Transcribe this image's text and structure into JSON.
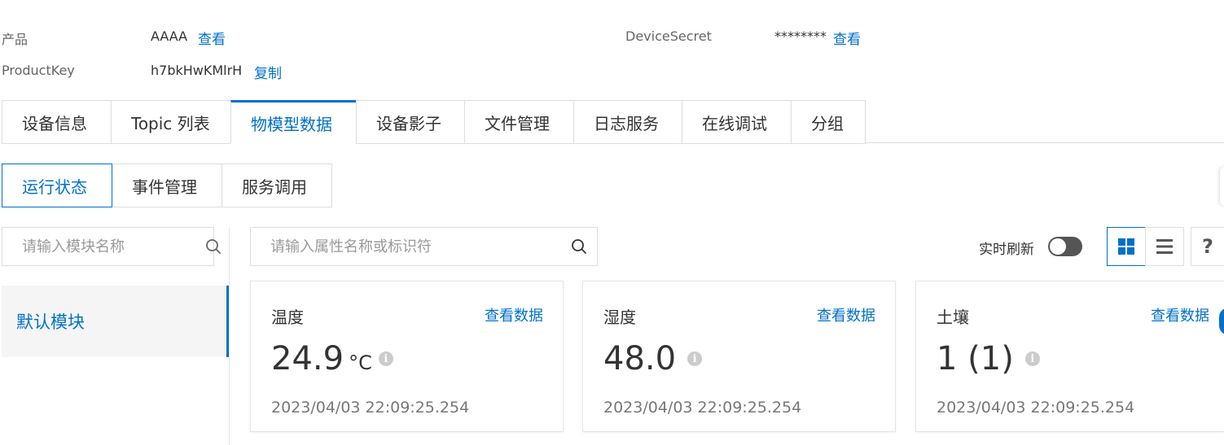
{
  "product_info": {
    "product_label": "产品",
    "product_value": "AAAA",
    "product_view": "查看",
    "secret_label": "DeviceSecret",
    "secret_value": "********",
    "secret_view": "查看",
    "productkey_label": "ProductKey",
    "productkey_value": "h7bkHwKMlrH",
    "productkey_copy": "复制"
  },
  "main_tabs": [
    {
      "label": "设备信息"
    },
    {
      "label": "Topic 列表"
    },
    {
      "label": "物模型数据",
      "active": true
    },
    {
      "label": "设备影子"
    },
    {
      "label": "文件管理"
    },
    {
      "label": "日志服务"
    },
    {
      "label": "在线调试"
    },
    {
      "label": "分组"
    }
  ],
  "sub_tabs": [
    {
      "label": "运行状态",
      "active": true
    },
    {
      "label": "事件管理"
    },
    {
      "label": "服务调用"
    }
  ],
  "module_search": {
    "placeholder": "请输入模块名称"
  },
  "property_search": {
    "placeholder": "请输入属性名称或标识符"
  },
  "modules": [
    {
      "label": "默认模块",
      "active": true
    }
  ],
  "toolbar": {
    "refresh_label": "实时刷新",
    "refresh_on": false,
    "help": "?"
  },
  "cards": [
    {
      "title": "温度",
      "link": "查看数据",
      "value": "24.9",
      "unit": "°C",
      "time": "2023/04/03 22:09:25.254"
    },
    {
      "title": "湿度",
      "link": "查看数据",
      "value": "48.0",
      "unit": "",
      "time": "2023/04/03 22:09:25.254"
    },
    {
      "title": "土壤",
      "link": "查看数据",
      "value": "1 (1)",
      "unit": "",
      "time": "2023/04/03 22:09:25.254"
    }
  ],
  "colors": {
    "accent": "#0070cc",
    "border": "#dddddd",
    "muted": "#999999"
  }
}
